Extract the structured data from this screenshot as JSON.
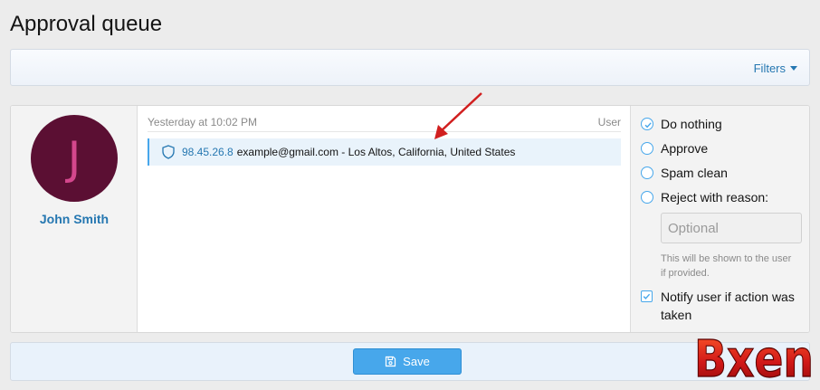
{
  "page": {
    "title": "Approval queue"
  },
  "filter_bar": {
    "filters_label": "Filters"
  },
  "item": {
    "user": {
      "initial": "J",
      "name": "John Smith"
    },
    "timestamp": "Yesterday at 10:02 PM",
    "content_type": "User",
    "ip": "98.45.26.8",
    "details": "example@gmail.com - Los Altos, California, United States"
  },
  "actions": {
    "options": [
      "Do nothing",
      "Approve",
      "Spam clean",
      "Reject with reason:"
    ],
    "selected": "Do nothing",
    "reason_placeholder": "Optional",
    "reason_hint": "This will be shown to the user if provided.",
    "notify_label": "Notify user if action was taken",
    "notify_checked": true
  },
  "save_bar": {
    "save_label": "Save"
  },
  "watermark": {
    "text": "Bxen"
  },
  "colors": {
    "accent": "#47a7eb",
    "link": "#2577b1",
    "avatar_bg": "#5b0f33",
    "avatar_letter": "#d4478d",
    "annotation_arrow": "#d11f1f"
  },
  "icons": [
    "caret-down-icon",
    "shield-icon",
    "check-icon",
    "save-icon",
    "arrow-annotation"
  ]
}
